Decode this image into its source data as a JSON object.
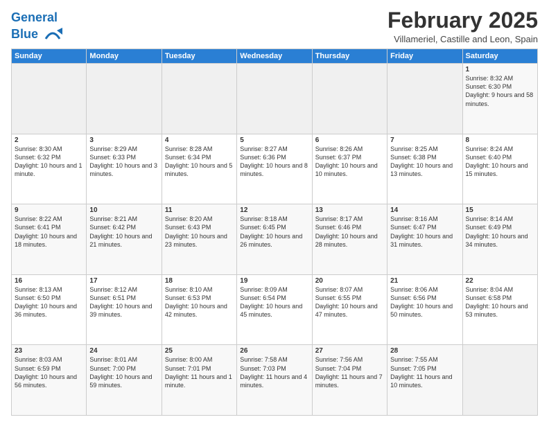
{
  "header": {
    "logo_line1": "General",
    "logo_line2": "Blue",
    "month_title": "February 2025",
    "location": "Villameriel, Castille and Leon, Spain"
  },
  "weekdays": [
    "Sunday",
    "Monday",
    "Tuesday",
    "Wednesday",
    "Thursday",
    "Friday",
    "Saturday"
  ],
  "weeks": [
    [
      {
        "day": "",
        "info": ""
      },
      {
        "day": "",
        "info": ""
      },
      {
        "day": "",
        "info": ""
      },
      {
        "day": "",
        "info": ""
      },
      {
        "day": "",
        "info": ""
      },
      {
        "day": "",
        "info": ""
      },
      {
        "day": "1",
        "info": "Sunrise: 8:32 AM\nSunset: 6:30 PM\nDaylight: 9 hours and 58 minutes."
      }
    ],
    [
      {
        "day": "2",
        "info": "Sunrise: 8:30 AM\nSunset: 6:32 PM\nDaylight: 10 hours and 1 minute."
      },
      {
        "day": "3",
        "info": "Sunrise: 8:29 AM\nSunset: 6:33 PM\nDaylight: 10 hours and 3 minutes."
      },
      {
        "day": "4",
        "info": "Sunrise: 8:28 AM\nSunset: 6:34 PM\nDaylight: 10 hours and 5 minutes."
      },
      {
        "day": "5",
        "info": "Sunrise: 8:27 AM\nSunset: 6:36 PM\nDaylight: 10 hours and 8 minutes."
      },
      {
        "day": "6",
        "info": "Sunrise: 8:26 AM\nSunset: 6:37 PM\nDaylight: 10 hours and 10 minutes."
      },
      {
        "day": "7",
        "info": "Sunrise: 8:25 AM\nSunset: 6:38 PM\nDaylight: 10 hours and 13 minutes."
      },
      {
        "day": "8",
        "info": "Sunrise: 8:24 AM\nSunset: 6:40 PM\nDaylight: 10 hours and 15 minutes."
      }
    ],
    [
      {
        "day": "9",
        "info": "Sunrise: 8:22 AM\nSunset: 6:41 PM\nDaylight: 10 hours and 18 minutes."
      },
      {
        "day": "10",
        "info": "Sunrise: 8:21 AM\nSunset: 6:42 PM\nDaylight: 10 hours and 21 minutes."
      },
      {
        "day": "11",
        "info": "Sunrise: 8:20 AM\nSunset: 6:43 PM\nDaylight: 10 hours and 23 minutes."
      },
      {
        "day": "12",
        "info": "Sunrise: 8:18 AM\nSunset: 6:45 PM\nDaylight: 10 hours and 26 minutes."
      },
      {
        "day": "13",
        "info": "Sunrise: 8:17 AM\nSunset: 6:46 PM\nDaylight: 10 hours and 28 minutes."
      },
      {
        "day": "14",
        "info": "Sunrise: 8:16 AM\nSunset: 6:47 PM\nDaylight: 10 hours and 31 minutes."
      },
      {
        "day": "15",
        "info": "Sunrise: 8:14 AM\nSunset: 6:49 PM\nDaylight: 10 hours and 34 minutes."
      }
    ],
    [
      {
        "day": "16",
        "info": "Sunrise: 8:13 AM\nSunset: 6:50 PM\nDaylight: 10 hours and 36 minutes."
      },
      {
        "day": "17",
        "info": "Sunrise: 8:12 AM\nSunset: 6:51 PM\nDaylight: 10 hours and 39 minutes."
      },
      {
        "day": "18",
        "info": "Sunrise: 8:10 AM\nSunset: 6:53 PM\nDaylight: 10 hours and 42 minutes."
      },
      {
        "day": "19",
        "info": "Sunrise: 8:09 AM\nSunset: 6:54 PM\nDaylight: 10 hours and 45 minutes."
      },
      {
        "day": "20",
        "info": "Sunrise: 8:07 AM\nSunset: 6:55 PM\nDaylight: 10 hours and 47 minutes."
      },
      {
        "day": "21",
        "info": "Sunrise: 8:06 AM\nSunset: 6:56 PM\nDaylight: 10 hours and 50 minutes."
      },
      {
        "day": "22",
        "info": "Sunrise: 8:04 AM\nSunset: 6:58 PM\nDaylight: 10 hours and 53 minutes."
      }
    ],
    [
      {
        "day": "23",
        "info": "Sunrise: 8:03 AM\nSunset: 6:59 PM\nDaylight: 10 hours and 56 minutes."
      },
      {
        "day": "24",
        "info": "Sunrise: 8:01 AM\nSunset: 7:00 PM\nDaylight: 10 hours and 59 minutes."
      },
      {
        "day": "25",
        "info": "Sunrise: 8:00 AM\nSunset: 7:01 PM\nDaylight: 11 hours and 1 minute."
      },
      {
        "day": "26",
        "info": "Sunrise: 7:58 AM\nSunset: 7:03 PM\nDaylight: 11 hours and 4 minutes."
      },
      {
        "day": "27",
        "info": "Sunrise: 7:56 AM\nSunset: 7:04 PM\nDaylight: 11 hours and 7 minutes."
      },
      {
        "day": "28",
        "info": "Sunrise: 7:55 AM\nSunset: 7:05 PM\nDaylight: 11 hours and 10 minutes."
      },
      {
        "day": "",
        "info": ""
      }
    ]
  ]
}
